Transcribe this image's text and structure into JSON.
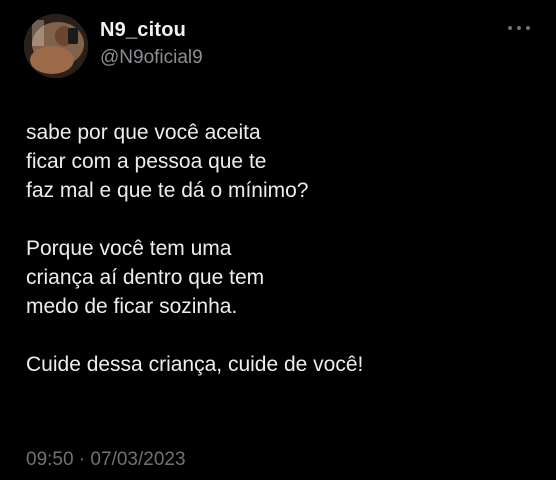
{
  "tweet": {
    "display_name": "N9_citou",
    "handle": "@N9oficial9",
    "more_icon": "ellipsis-icon",
    "body": {
      "paragraph1": [
        "sabe por que você aceita",
        "ficar com a pessoa que te",
        "faz mal e que te dá o mínimo?"
      ],
      "paragraph2": [
        "Porque você tem uma",
        "criança aí dentro que tem",
        "medo de ficar sozinha."
      ],
      "paragraph3": [
        "Cuide dessa criança, cuide de você!"
      ]
    },
    "timestamp": "09:50 · 07/03/2023"
  },
  "colors": {
    "background": "#000000",
    "text": "#e7e9ea",
    "secondary": "#8b8f94"
  }
}
